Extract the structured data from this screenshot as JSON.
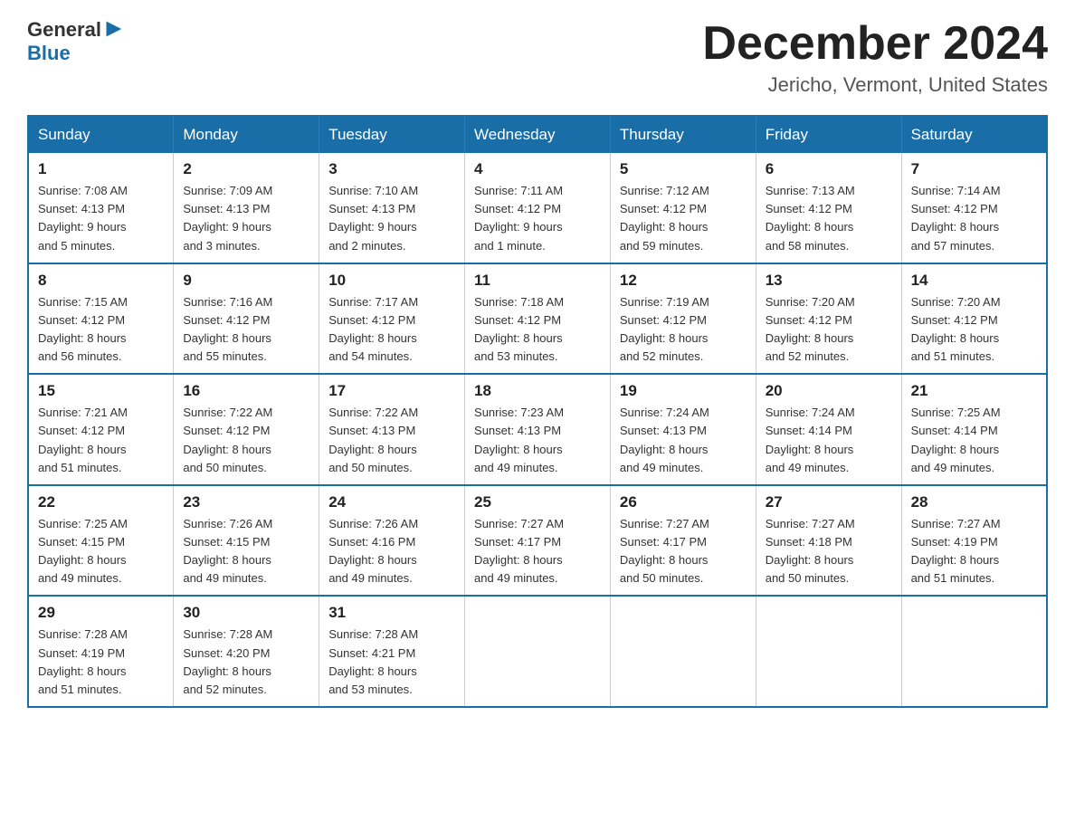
{
  "header": {
    "logo_general": "General",
    "logo_blue": "Blue",
    "title": "December 2024",
    "subtitle": "Jericho, Vermont, United States"
  },
  "weekdays": [
    "Sunday",
    "Monday",
    "Tuesday",
    "Wednesday",
    "Thursday",
    "Friday",
    "Saturday"
  ],
  "weeks": [
    [
      {
        "day": "1",
        "sunrise": "7:08 AM",
        "sunset": "4:13 PM",
        "daylight": "9 hours and 5 minutes."
      },
      {
        "day": "2",
        "sunrise": "7:09 AM",
        "sunset": "4:13 PM",
        "daylight": "9 hours and 3 minutes."
      },
      {
        "day": "3",
        "sunrise": "7:10 AM",
        "sunset": "4:13 PM",
        "daylight": "9 hours and 2 minutes."
      },
      {
        "day": "4",
        "sunrise": "7:11 AM",
        "sunset": "4:12 PM",
        "daylight": "9 hours and 1 minute."
      },
      {
        "day": "5",
        "sunrise": "7:12 AM",
        "sunset": "4:12 PM",
        "daylight": "8 hours and 59 minutes."
      },
      {
        "day": "6",
        "sunrise": "7:13 AM",
        "sunset": "4:12 PM",
        "daylight": "8 hours and 58 minutes."
      },
      {
        "day": "7",
        "sunrise": "7:14 AM",
        "sunset": "4:12 PM",
        "daylight": "8 hours and 57 minutes."
      }
    ],
    [
      {
        "day": "8",
        "sunrise": "7:15 AM",
        "sunset": "4:12 PM",
        "daylight": "8 hours and 56 minutes."
      },
      {
        "day": "9",
        "sunrise": "7:16 AM",
        "sunset": "4:12 PM",
        "daylight": "8 hours and 55 minutes."
      },
      {
        "day": "10",
        "sunrise": "7:17 AM",
        "sunset": "4:12 PM",
        "daylight": "8 hours and 54 minutes."
      },
      {
        "day": "11",
        "sunrise": "7:18 AM",
        "sunset": "4:12 PM",
        "daylight": "8 hours and 53 minutes."
      },
      {
        "day": "12",
        "sunrise": "7:19 AM",
        "sunset": "4:12 PM",
        "daylight": "8 hours and 52 minutes."
      },
      {
        "day": "13",
        "sunrise": "7:20 AM",
        "sunset": "4:12 PM",
        "daylight": "8 hours and 52 minutes."
      },
      {
        "day": "14",
        "sunrise": "7:20 AM",
        "sunset": "4:12 PM",
        "daylight": "8 hours and 51 minutes."
      }
    ],
    [
      {
        "day": "15",
        "sunrise": "7:21 AM",
        "sunset": "4:12 PM",
        "daylight": "8 hours and 51 minutes."
      },
      {
        "day": "16",
        "sunrise": "7:22 AM",
        "sunset": "4:12 PM",
        "daylight": "8 hours and 50 minutes."
      },
      {
        "day": "17",
        "sunrise": "7:22 AM",
        "sunset": "4:13 PM",
        "daylight": "8 hours and 50 minutes."
      },
      {
        "day": "18",
        "sunrise": "7:23 AM",
        "sunset": "4:13 PM",
        "daylight": "8 hours and 49 minutes."
      },
      {
        "day": "19",
        "sunrise": "7:24 AM",
        "sunset": "4:13 PM",
        "daylight": "8 hours and 49 minutes."
      },
      {
        "day": "20",
        "sunrise": "7:24 AM",
        "sunset": "4:14 PM",
        "daylight": "8 hours and 49 minutes."
      },
      {
        "day": "21",
        "sunrise": "7:25 AM",
        "sunset": "4:14 PM",
        "daylight": "8 hours and 49 minutes."
      }
    ],
    [
      {
        "day": "22",
        "sunrise": "7:25 AM",
        "sunset": "4:15 PM",
        "daylight": "8 hours and 49 minutes."
      },
      {
        "day": "23",
        "sunrise": "7:26 AM",
        "sunset": "4:15 PM",
        "daylight": "8 hours and 49 minutes."
      },
      {
        "day": "24",
        "sunrise": "7:26 AM",
        "sunset": "4:16 PM",
        "daylight": "8 hours and 49 minutes."
      },
      {
        "day": "25",
        "sunrise": "7:27 AM",
        "sunset": "4:17 PM",
        "daylight": "8 hours and 49 minutes."
      },
      {
        "day": "26",
        "sunrise": "7:27 AM",
        "sunset": "4:17 PM",
        "daylight": "8 hours and 50 minutes."
      },
      {
        "day": "27",
        "sunrise": "7:27 AM",
        "sunset": "4:18 PM",
        "daylight": "8 hours and 50 minutes."
      },
      {
        "day": "28",
        "sunrise": "7:27 AM",
        "sunset": "4:19 PM",
        "daylight": "8 hours and 51 minutes."
      }
    ],
    [
      {
        "day": "29",
        "sunrise": "7:28 AM",
        "sunset": "4:19 PM",
        "daylight": "8 hours and 51 minutes."
      },
      {
        "day": "30",
        "sunrise": "7:28 AM",
        "sunset": "4:20 PM",
        "daylight": "8 hours and 52 minutes."
      },
      {
        "day": "31",
        "sunrise": "7:28 AM",
        "sunset": "4:21 PM",
        "daylight": "8 hours and 53 minutes."
      },
      null,
      null,
      null,
      null
    ]
  ],
  "labels": {
    "sunrise": "Sunrise: ",
    "sunset": "Sunset: ",
    "daylight": "Daylight: "
  }
}
